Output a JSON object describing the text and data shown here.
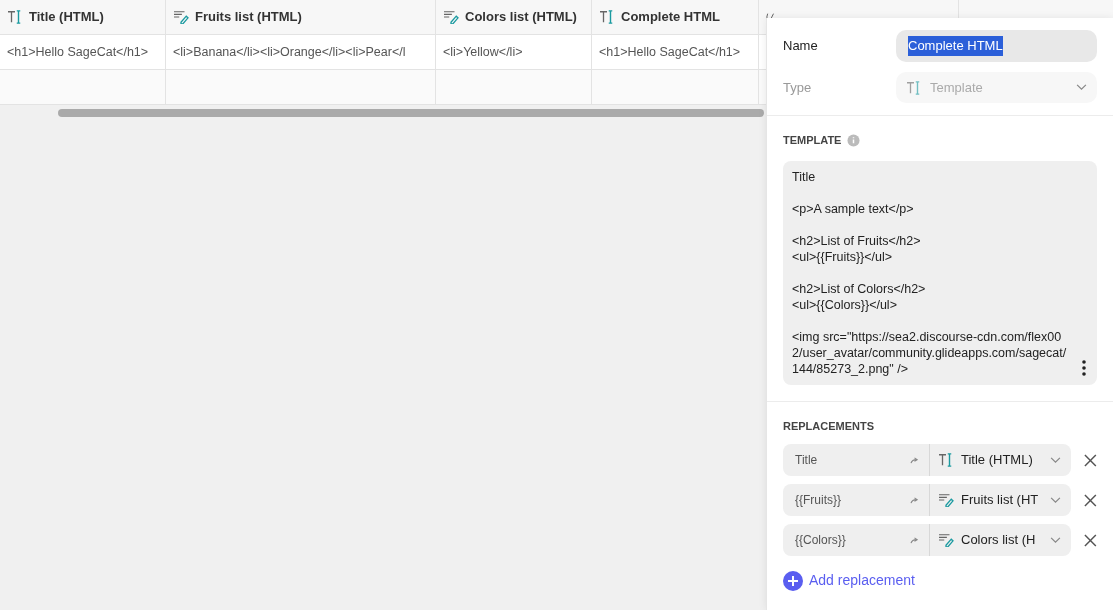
{
  "table": {
    "columns": [
      {
        "label": "Title (HTML)",
        "kind": "text"
      },
      {
        "label": "Fruits list (HTML)",
        "kind": "list"
      },
      {
        "label": "Colors list (HTML)",
        "kind": "list"
      },
      {
        "label": "Complete HTML",
        "kind": "text"
      },
      {
        "kind": "code"
      }
    ],
    "rows": [
      [
        "<h1>Hello SageCat</h1>",
        "<li>Banana</li><li>Orange</li><li>Pear</l",
        "<li>Yellow</li>",
        "<h1>Hello SageCat</h1>"
      ]
    ]
  },
  "panel": {
    "name": {
      "label": "Name",
      "value": "Complete HTML"
    },
    "type": {
      "label": "Type",
      "value": "Template",
      "kind": "text",
      "disabled": true
    },
    "template": {
      "heading": "TEMPLATE",
      "text": "Title\n\n<p>A sample text</p>\n\n<h2>List of Fruits</h2>\n<ul>{{Fruits}}</ul>\n\n<h2>List of Colors</h2>\n<ul>{{Colors}}</ul>\n\n<img src=\"https://sea2.discourse-cdn.com/flex002/user_avatar/community.glideapps.com/sagecat/144/85273_2.png\" />"
    },
    "replacements": {
      "heading": "REPLACEMENTS",
      "items": [
        {
          "placeholder": "Title",
          "column": "Title (HTML)",
          "kind": "text"
        },
        {
          "placeholder": "{{Fruits}}",
          "column": "Fruits list (HT",
          "kind": "list"
        },
        {
          "placeholder": "{{Colors}}",
          "column": "Colors list (H",
          "kind": "list"
        }
      ],
      "add_label": "Add replacement"
    }
  }
}
